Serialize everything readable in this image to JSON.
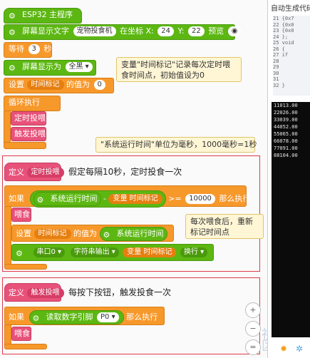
{
  "program": {
    "header": "ESP32 主程序",
    "oled_label": "屏幕显示文字",
    "oled_text": "宠物投食机",
    "oled_coord": "在坐标 X:",
    "oled_x": "24",
    "oled_y_label": "Y:",
    "oled_y": "22",
    "oled_preview": "预览",
    "wait_label": "等待",
    "wait_val": "3",
    "wait_unit": "秒",
    "screen_label": "屏幕显示为",
    "screen_val": "全黑",
    "set_label": "设置",
    "set_var": "时间标记",
    "set_of": "的值为",
    "set_val": "0",
    "loop_label": "循环执行",
    "call_timer": "定时投喂",
    "call_button": "触发投喂"
  },
  "notes": {
    "note1": "变量\"时间标记\"记录每次定时喂食时间点，初始值设为0",
    "note2": "\"系统运行时间\"单位为毫秒，1000毫秒=1秒",
    "note3": "每次喂食后，重新标记时间点"
  },
  "timer_func": {
    "def_label": "定义",
    "name": "定时投喂",
    "desc": "假定每隔10秒，定时投食一次",
    "if": "如果",
    "uptime": "系统运行时间",
    "minus": "-",
    "var_label": "变量",
    "var_name": "时间标记",
    "op": ">=",
    "threshold": "10000",
    "then": "那么执行",
    "feed": "喂食",
    "set": "设置",
    "set_var": "时间标记",
    "set_of": "的值为",
    "set_uptime": "系统运行时间",
    "serial": "串口0",
    "serial_fn": "字符串输出",
    "serial_var_label": "变量",
    "serial_var": "时间标记",
    "newline": "换行"
  },
  "button_func": {
    "def_label": "定义",
    "name": "触发投喂",
    "desc": "每按下按钮，触发投食一次",
    "if": "如果",
    "read": "读取数字引脚",
    "pin": "P0",
    "then": "那么执行",
    "feed": "喂食"
  },
  "right_panel": {
    "title": "自动生成代码",
    "code": [
      "21  {0x7",
      "22  {0x0",
      "23  {0x0",
      "24  };",
      "25  void",
      "26  {",
      "27   if",
      "28",
      "29",
      "30",
      "31",
      "32  }"
    ],
    "console": [
      "11013.00",
      "22026.00",
      "33039.00",
      "44052.00",
      "55065.00",
      "66078.00",
      "77091.00",
      "88104.00"
    ]
  },
  "zoom": {
    "in": "+",
    "out": "−",
    "reset": "="
  },
  "watermark": "社区",
  "colors": {
    "green": "#5cb712",
    "orange": "#f7982b",
    "pink": "#e8527a",
    "note": "#fff6d6",
    "red": "#e23a4a"
  }
}
